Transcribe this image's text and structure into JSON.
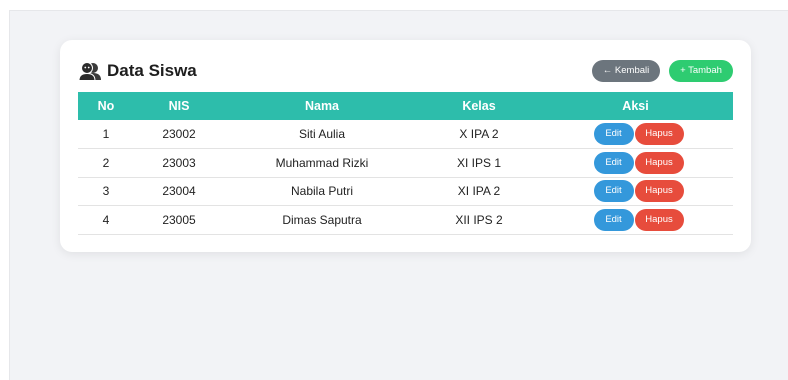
{
  "card": {
    "title": "Data Siswa",
    "title_icon": "people-icon",
    "back_label": "← Kembali",
    "add_label": "+ Tambah"
  },
  "table": {
    "headers": {
      "no": "No",
      "nis": "NIS",
      "nama": "Nama",
      "kelas": "Kelas",
      "aksi": "Aksi"
    },
    "rows": [
      {
        "no": "1",
        "nis": "23002",
        "nama": "Siti Aulia",
        "kelas": "X IPA 2",
        "edit": "Edit",
        "hapus": "Hapus"
      },
      {
        "no": "2",
        "nis": "23003",
        "nama": "Muhammad Rizki",
        "kelas": "XI IPS 1",
        "edit": "Edit",
        "hapus": "Hapus"
      },
      {
        "no": "3",
        "nis": "23004",
        "nama": "Nabila Putri",
        "kelas": "XI IPA 2",
        "edit": "Edit",
        "hapus": "Hapus"
      },
      {
        "no": "4",
        "nis": "23005",
        "nama": "Dimas Saputra",
        "kelas": "XII IPS 2",
        "edit": "Edit",
        "hapus": "Hapus"
      }
    ]
  },
  "colors": {
    "header_bg": "#2dbdab",
    "back_button": "#6c757d",
    "add_button": "#2ecc71",
    "edit_button": "#3498db",
    "delete_button": "#e74c3c"
  }
}
